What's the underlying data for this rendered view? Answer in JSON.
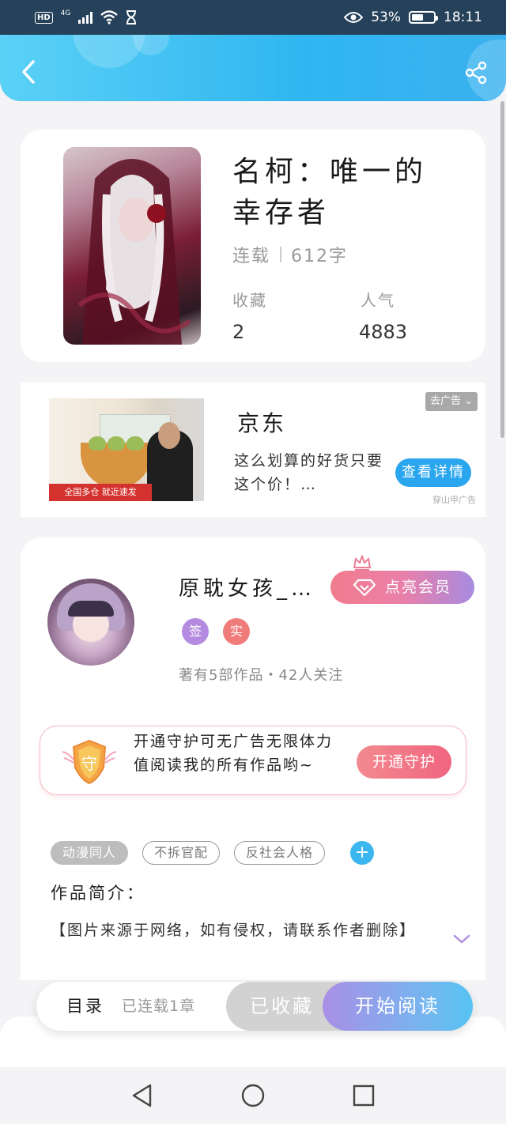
{
  "status_bar": {
    "left_label": "HD",
    "network": "4G",
    "battery": "53%",
    "battery_level": 0.53,
    "time": "18:11"
  },
  "header": {
    "back_icon": "chevron-left-icon",
    "share_icon": "share-icon"
  },
  "book": {
    "title": "名柯：唯一的幸存者",
    "status": "连载",
    "word_count": "612字",
    "favorites_label": "收藏",
    "favorites_value": "2",
    "popularity_label": "人气",
    "popularity_value": "4883"
  },
  "ad": {
    "brand": "京东",
    "description": "这么划算的好货只要这个价！…",
    "close_label": "去广告",
    "button_label": "查看详情",
    "source": "穿山甲广告",
    "banner_text": "全国多仓 就近速发"
  },
  "author": {
    "name": "原耽女孩_…",
    "vip_label": "点亮会员",
    "badge_sign": "签",
    "badge_real": "实",
    "stats": "著有5部作品・42人关注",
    "sign_color": "#b48be0",
    "real_color": "#f07b7b"
  },
  "guard": {
    "icon_char": "守",
    "text": "开通守护可无广告无限体力值阅读我的所有作品哟~",
    "button_label": "开通守护"
  },
  "tags": {
    "items": [
      "动漫同人",
      "不拆官配",
      "反社会人格"
    ],
    "add_label": "+"
  },
  "intro": {
    "label": "作品简介：",
    "text": "【图片来源于网络，如有侵权，请联系作者删除】"
  },
  "bottom": {
    "toc_label": "目录",
    "toc_count": "已连载1章",
    "favorited_label": "已收藏",
    "read_label": "开始阅读"
  },
  "theme": {
    "accent": "#2fb6f0",
    "brand_gradient": [
      "#5bd1f7",
      "#3ab1ef"
    ]
  }
}
